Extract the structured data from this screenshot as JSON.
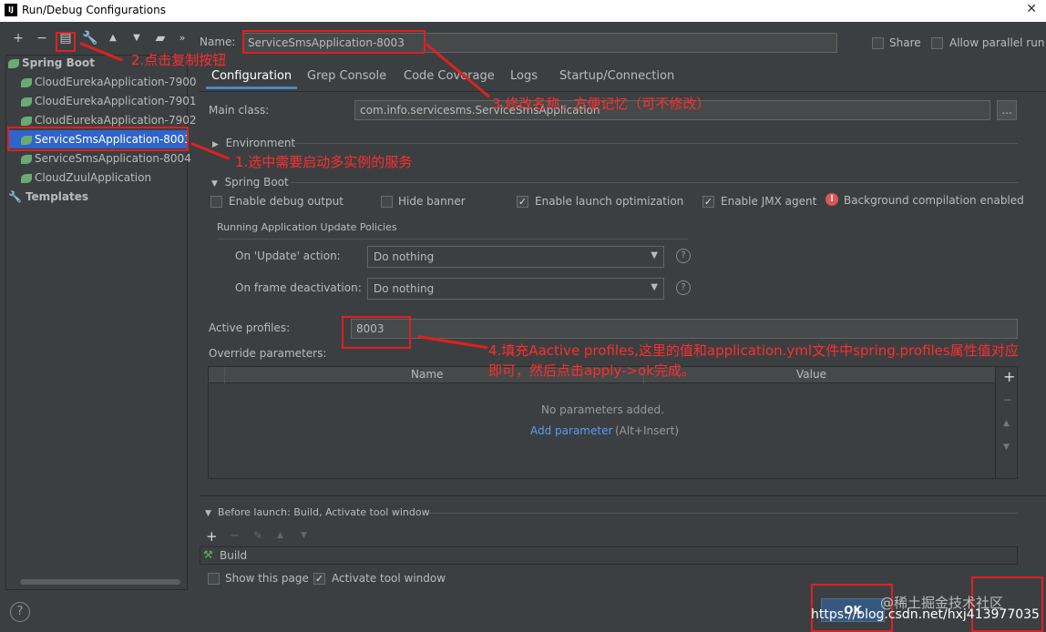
{
  "window": {
    "title": "Run/Debug Configurations",
    "app_icon": "IJ",
    "close_glyph": "✕"
  },
  "toolbar": {
    "icons": [
      "add-icon",
      "remove-icon",
      "copy-icon",
      "wrench-icon",
      "move-up-icon",
      "move-down-icon",
      "folder-icon",
      "more-icon"
    ]
  },
  "tree": {
    "group": "Spring Boot",
    "items": [
      "CloudEurekaApplication-7900",
      "CloudEurekaApplication-7901",
      "CloudEurekaApplication-7902",
      "ServiceSmsApplication-8003",
      "ServiceSmsApplication-8004",
      "CloudZuulApplication"
    ],
    "selected_index": 3,
    "templates": "Templates"
  },
  "name_row": {
    "label": "Name:",
    "value": "ServiceSmsApplication-8003",
    "share": "Share",
    "allow_parallel": "Allow parallel run"
  },
  "tabs": [
    "Configuration",
    "Grep Console",
    "Code Coverage",
    "Logs",
    "Startup/Connection"
  ],
  "main_class": {
    "label": "Main class:",
    "value": "com.info.servicesms.ServiceSmsApplication",
    "button": "..."
  },
  "environment": {
    "label": "Environment"
  },
  "spring_boot": {
    "label": "Spring Boot",
    "options": [
      {
        "label": "Enable debug output",
        "checked": false
      },
      {
        "label": "Hide banner",
        "checked": false
      },
      {
        "label": "Enable launch optimization",
        "checked": true
      },
      {
        "label": "Enable JMX agent",
        "checked": true
      }
    ],
    "warning": "Background compilation enabled"
  },
  "update_policies": {
    "header": "Running Application Update Policies",
    "update_label": "On 'Update' action:",
    "update_value": "Do nothing",
    "frame_label": "On frame deactivation:",
    "frame_value": "Do nothing"
  },
  "profiles": {
    "label": "Active profiles:",
    "value": "8003"
  },
  "override": {
    "label": "Override parameters:",
    "col_name": "Name",
    "col_value": "Value",
    "empty": "No parameters added.",
    "add_link": "Add parameter",
    "add_hint": "(Alt+Insert)"
  },
  "before_launch": {
    "label": "Before launch: Build, Activate tool window",
    "item": "Build"
  },
  "bottom": {
    "show_page": "Show this page",
    "activate_tool": "Activate tool window",
    "ok": "OK",
    "help": "?"
  },
  "annotations": {
    "a1": "1.选中需要启动多实例的服务",
    "a2": "2.点击复制按钮",
    "a3": "3.修改名称，方便记忆（可不修改）",
    "a4_line1": "4.填充Aactive profiles,这里的值和application.yml文件中spring.profiles属性值对应",
    "a4_line2": "即可，然后点击apply->ok完成。"
  },
  "watermark": {
    "line1": "@稀土掘金技术社区",
    "line2": "https://blog.csdn.net/hxj413977035"
  },
  "colors": {
    "accent": "#4a88c7",
    "selected": "#2f65ca",
    "annotation": "#e02020",
    "link": "#589df6"
  }
}
